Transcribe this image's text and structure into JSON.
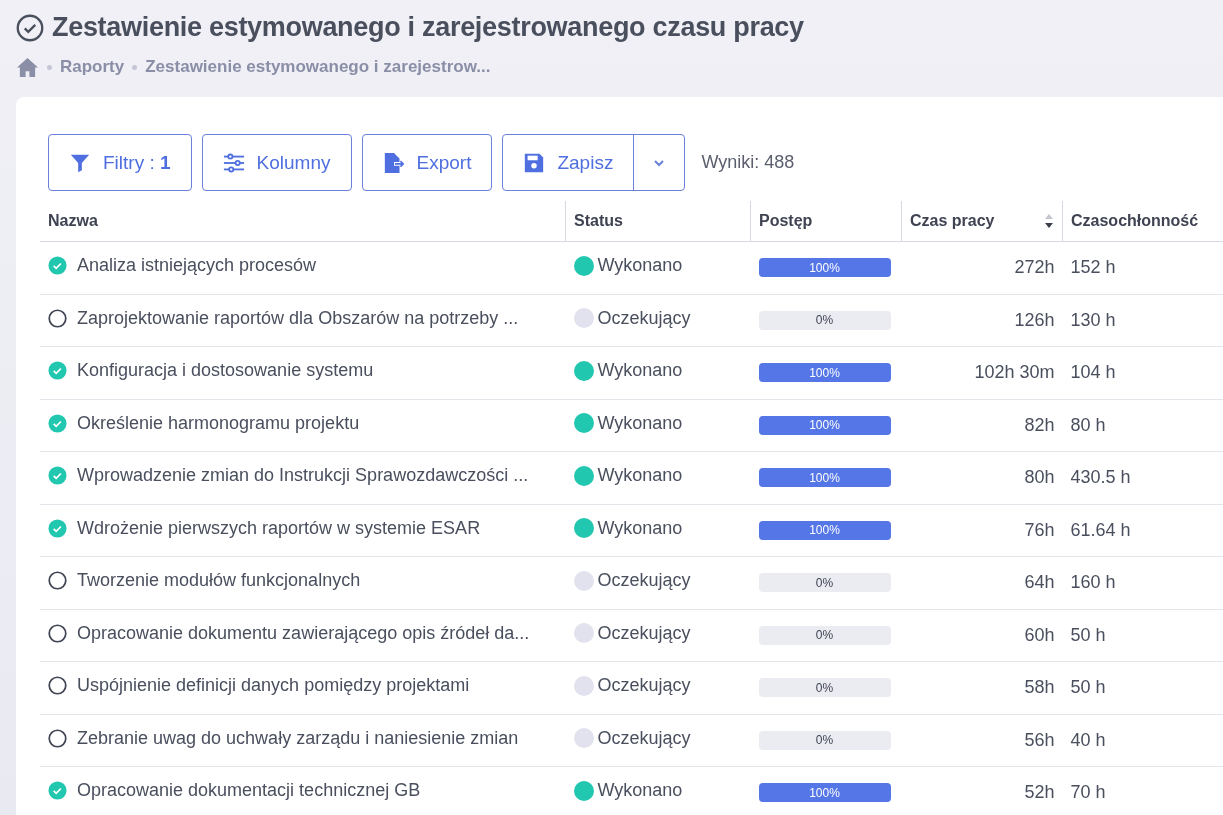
{
  "page": {
    "title": "Zestawienie estymowanego i zarejestrowanego czasu pracy"
  },
  "breadcrumb": [
    "Raporty",
    "Zestawienie estymowanego i zarejestrow..."
  ],
  "toolbar": {
    "filters": "Filtry : **1**",
    "columns": "Kolumny",
    "export": "Export",
    "save": "Zapisz",
    "results": "Wyniki: 488"
  },
  "table": {
    "columns": [
      {
        "label": "Nazwa",
        "sortable": false
      },
      {
        "label": "Status",
        "sortable": false
      },
      {
        "label": "Postęp",
        "sortable": false
      },
      {
        "label": "Czas pracy",
        "sortable": true
      },
      {
        "label": "Czasochłonność",
        "sortable": false
      }
    ],
    "rows": [
      {
        "done": true,
        "name": "Analiza istniejących procesów",
        "status": "Wykonano",
        "color": "#22c7b0",
        "level": 1,
        "progress": "100%",
        "time": "272h",
        "estimate": "152 h"
      },
      {
        "done": false,
        "name": "Zaprojektowanie raportów dla Obszarów na potrzeby ...",
        "status": "Oczekujący",
        "color": "#e2e2ee",
        "level": 0,
        "progress": "0%",
        "time": "126h",
        "estimate": "130 h"
      },
      {
        "done": true,
        "name": "Konfiguracja i dostosowanie systemu",
        "status": "Wykonano",
        "color": "#22c7b0",
        "level": 1,
        "progress": "100%",
        "time": "102h 30m",
        "estimate": "104 h"
      },
      {
        "done": true,
        "name": "Określenie harmonogramu projektu",
        "status": "Wykonano",
        "color": "#22c7b0",
        "level": 1,
        "progress": "100%",
        "time": "82h",
        "estimate": "80 h"
      },
      {
        "done": true,
        "name": "Wprowadzenie zmian do Instrukcji Sprawozdawczości ...",
        "status": "Wykonano",
        "color": "#22c7b0",
        "level": 1,
        "progress": "100%",
        "time": "80h",
        "estimate": "430.5 h"
      },
      {
        "done": true,
        "name": "Wdrożenie pierwszych raportów w systemie ESAR",
        "status": "Wykonano",
        "color": "#22c7b0",
        "level": 1,
        "progress": "100%",
        "time": "76h",
        "estimate": "61.64 h"
      },
      {
        "done": false,
        "name": "Tworzenie modułów funkcjonalnych",
        "status": "Oczekujący",
        "color": "#e2e2ee",
        "level": 0,
        "progress": "0%",
        "time": "64h",
        "estimate": "160 h"
      },
      {
        "done": false,
        "name": "Opracowanie dokumentu zawierającego opis źródeł da...",
        "status": "Oczekujący",
        "color": "#e2e2ee",
        "level": 0,
        "progress": "0%",
        "time": "60h",
        "estimate": "50 h"
      },
      {
        "done": false,
        "name": "Uspójnienie definicji danych pomiędzy projektami",
        "status": "Oczekujący",
        "color": "#e2e2ee",
        "level": 0,
        "progress": "0%",
        "time": "58h",
        "estimate": "50 h"
      },
      {
        "done": false,
        "name": "Zebranie uwag do uchwały zarządu i naniesienie zmian",
        "status": "Oczekujący",
        "color": "#e2e2ee",
        "level": 0,
        "progress": "0%",
        "time": "56h",
        "estimate": "40 h"
      },
      {
        "done": true,
        "name": "Opracowanie dokumentacji technicznej GB",
        "status": "Wykonano",
        "color": "#22c7b0",
        "level": 1,
        "progress": "100%",
        "time": "52h",
        "estimate": "70 h"
      }
    ]
  }
}
